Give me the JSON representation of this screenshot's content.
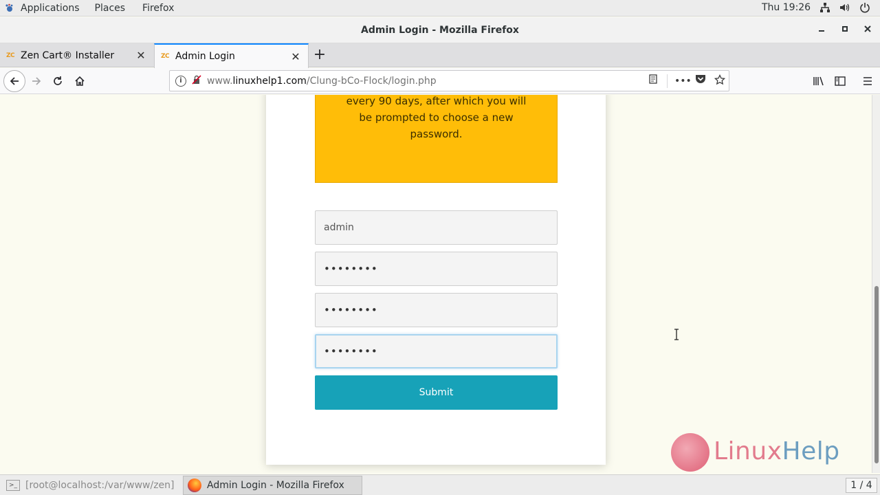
{
  "topbar": {
    "applications": "Applications",
    "places": "Places",
    "firefox": "Firefox",
    "clock": "Thu 19:26"
  },
  "window": {
    "title": "Admin Login - Mozilla Firefox"
  },
  "tabs": [
    {
      "label": "Zen Cart® Installer",
      "favicon": "ZC",
      "active": false
    },
    {
      "label": "Admin Login",
      "favicon": "ZC",
      "active": true
    }
  ],
  "url": {
    "prefix": "www.",
    "host": "linuxhelp1.com",
    "path": "/Clung-bCo-Flock/login.php"
  },
  "notice": {
    "text": "every 90 days, after which you will be prompted to choose a new password."
  },
  "form": {
    "username_value": "admin",
    "password_value": "••••••••",
    "new_password_value": "••••••••",
    "confirm_password_value": "••••••••",
    "submit_label": "Submit"
  },
  "logo": {
    "linux": "Linux",
    "help": "Help"
  },
  "taskbar": {
    "terminal_label": "[root@localhost:/var/www/zen]",
    "firefox_label": "Admin Login - Mozilla Firefox",
    "workspace": "1 / 4"
  },
  "colors": {
    "notice_bg": "#ffbd08",
    "submit_bg": "#17a2b8",
    "page_bg": "#fbfbf0",
    "tab_accent": "#0a84ff"
  }
}
